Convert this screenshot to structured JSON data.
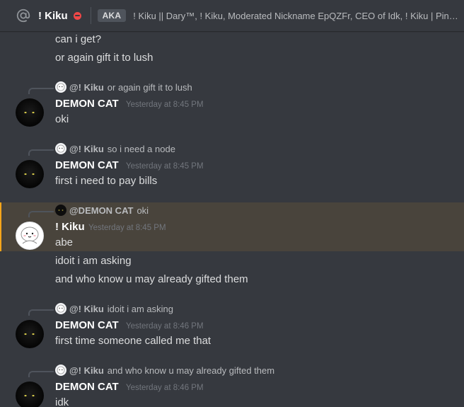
{
  "header": {
    "channel_name": "! Kiku",
    "aka_label": "AKA",
    "aka_names": "! Kiku || Dary™, ! Kiku, Moderated Nickname EpQZFr, CEO of Idk, ! Kiku | Ping..."
  },
  "colors": {
    "background": "#36393f",
    "mention_highlight": "#49443c",
    "mention_bar": "#faa61a",
    "dnd_status": "#f04747"
  },
  "messages": [
    {
      "text": "can i get?"
    },
    {
      "text": "or again gift it to lush"
    }
  ],
  "groups": [
    {
      "reply_author": "@! Kiku",
      "reply_text": "or again gift it to lush",
      "author": "DEMON CAT",
      "timestamp": "Yesterday at 8:45 PM",
      "lines": [
        "oki"
      ]
    },
    {
      "reply_author": "@! Kiku",
      "reply_text": "so i need a node",
      "author": "DEMON CAT",
      "timestamp": "Yesterday at 8:45 PM",
      "lines": [
        "first i need to pay bills"
      ]
    },
    {
      "reply_author": "@DEMON CAT",
      "reply_text": "oki",
      "author": "! Kiku",
      "timestamp": "Yesterday at 8:45 PM",
      "lines": [
        "abe",
        "idoit i am asking",
        "and who know u may already gifted them"
      ]
    },
    {
      "reply_author": "@! Kiku",
      "reply_text": "idoit i am asking",
      "author": "DEMON CAT",
      "timestamp": "Yesterday at 8:46 PM",
      "lines": [
        "first time someone called me that"
      ]
    },
    {
      "reply_author": "@! Kiku",
      "reply_text": "and who know u may already gifted them",
      "author": "DEMON CAT",
      "timestamp": "Yesterday at 8:46 PM",
      "lines": [
        "idk"
      ]
    }
  ]
}
